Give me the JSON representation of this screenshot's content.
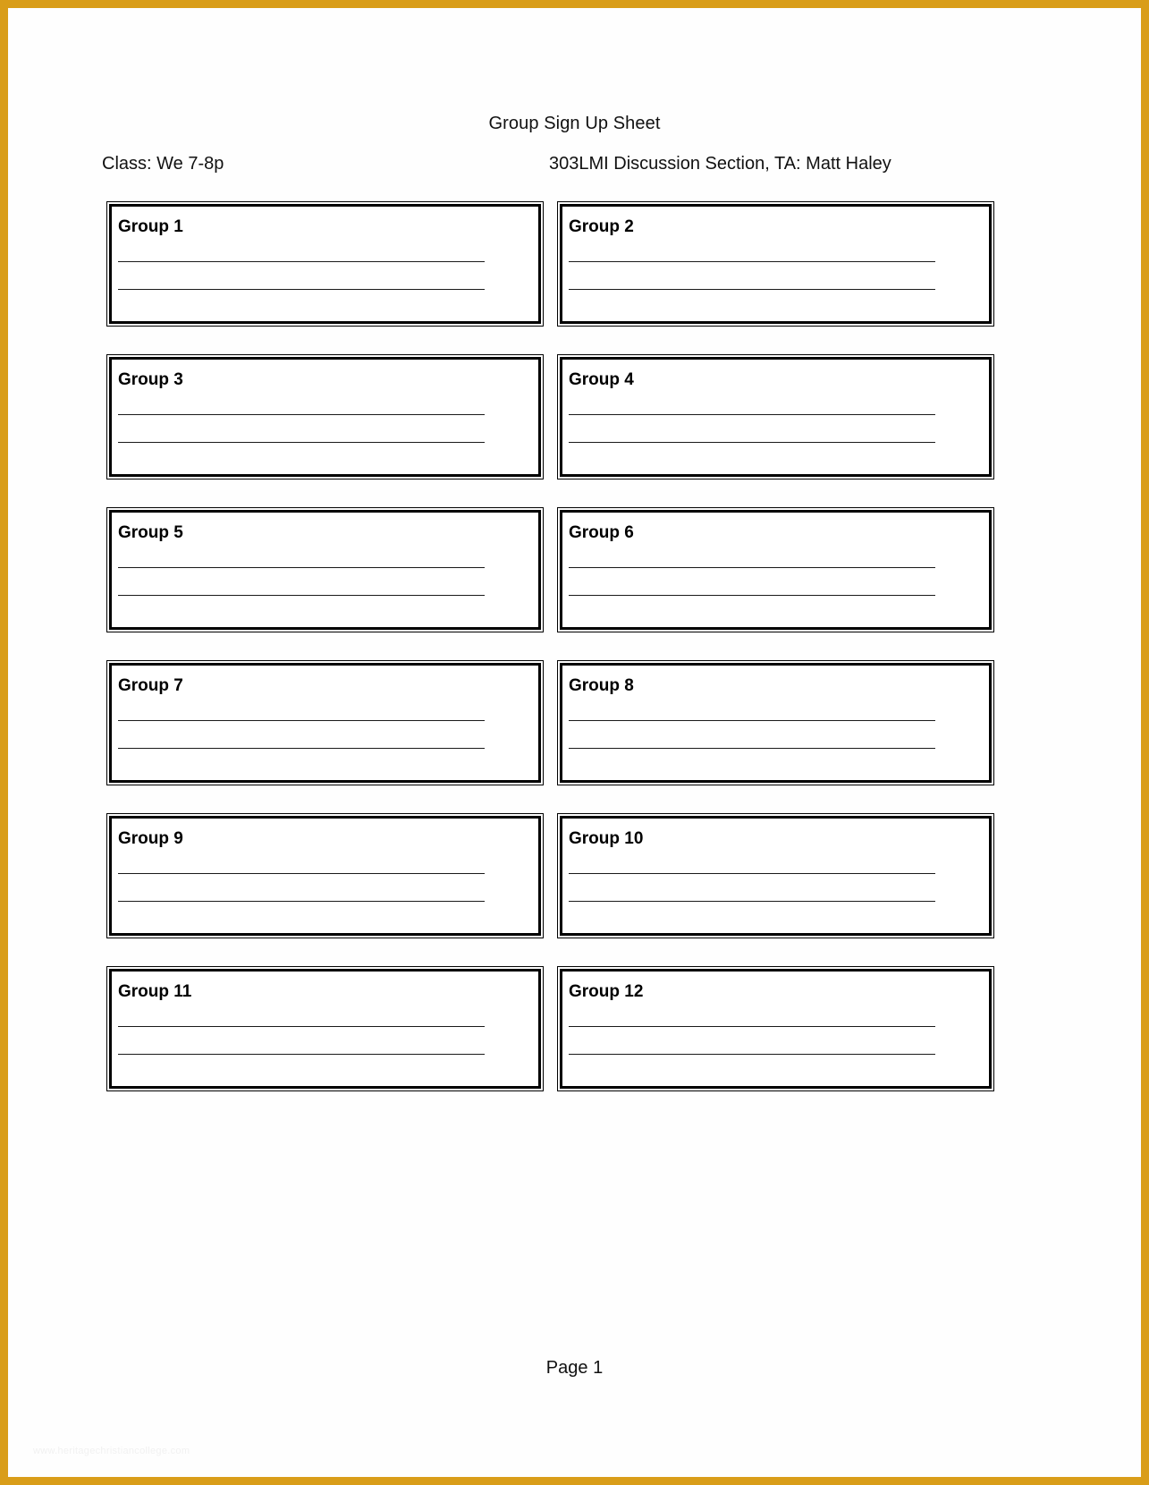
{
  "document": {
    "title": "Group Sign Up Sheet",
    "class_label": "Class: We 7-8p",
    "section_label": "303LMI Discussion Section, TA: Matt Haley",
    "page_number": "Page 1",
    "watermark": "www.heritagechristiancollege.com",
    "frame_color": "#d99d19",
    "text_color": "#111111",
    "rule_color": "#000000",
    "background_color": "#ffffff"
  },
  "groups": [
    {
      "label": "Group 1",
      "line_1": "",
      "line_2": ""
    },
    {
      "label": "Group 2",
      "line_1": "",
      "line_2": ""
    },
    {
      "label": "Group 3",
      "line_1": "",
      "line_2": ""
    },
    {
      "label": "Group 4",
      "line_1": "",
      "line_2": ""
    },
    {
      "label": "Group 5",
      "line_1": "",
      "line_2": ""
    },
    {
      "label": "Group 6",
      "line_1": "",
      "line_2": ""
    },
    {
      "label": "Group 7",
      "line_1": "",
      "line_2": ""
    },
    {
      "label": "Group 8",
      "line_1": "",
      "line_2": ""
    },
    {
      "label": "Group 9",
      "line_1": "",
      "line_2": ""
    },
    {
      "label": "Group 10",
      "line_1": "",
      "line_2": ""
    },
    {
      "label": "Group 11",
      "line_1": "",
      "line_2": ""
    },
    {
      "label": "Group 12",
      "line_1": "",
      "line_2": ""
    }
  ]
}
